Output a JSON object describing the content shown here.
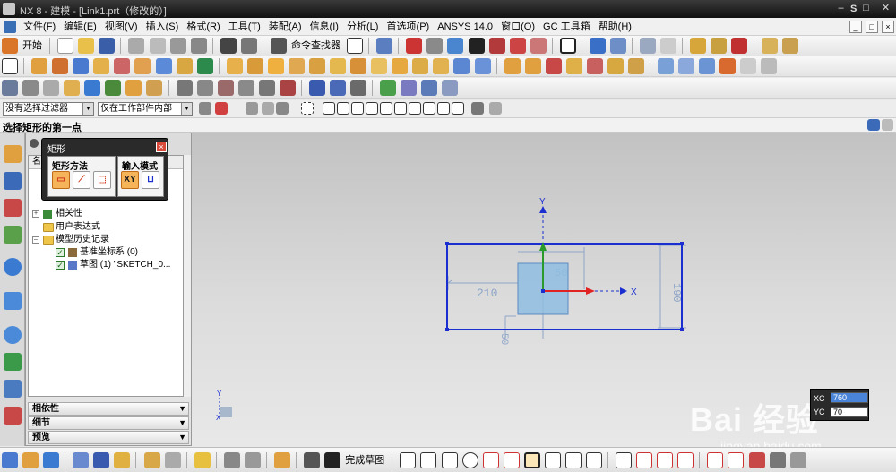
{
  "window": {
    "title": "NX 8 - 建模 - [Link1.prt（修改的）]",
    "right_label": "S",
    "minimize": "–",
    "maximize": "□",
    "close": "✕"
  },
  "menu": {
    "items": [
      "文件(F)",
      "编辑(E)",
      "视图(V)",
      "插入(S)",
      "格式(R)",
      "工具(T)",
      "装配(A)",
      "信息(I)",
      "分析(L)",
      "首选项(P)",
      "ANSYS 14.0",
      "窗口(O)",
      "GC 工具箱",
      "帮助(H)"
    ],
    "mdi_minimize": "_",
    "mdi_restore": "□",
    "mdi_close": "×"
  },
  "toolbar1": {
    "start_label": "开始",
    "command_finder_label": "命令查找器"
  },
  "selection_bar": {
    "filter_value": "没有选择过滤器",
    "scope_value": "仅在工作部件内部"
  },
  "prompt": {
    "text": "选择矩形的第一点"
  },
  "navigator": {
    "column_header": "名称",
    "items": [
      {
        "label": "相关性"
      },
      {
        "label": "用户表达式"
      },
      {
        "label": "模型历史记录"
      },
      {
        "label": "基准坐标系 (0)"
      },
      {
        "label": "草图 (1) \"SKETCH_0..."
      }
    ],
    "sections": [
      "相依性",
      "细节",
      "预览"
    ]
  },
  "rect_dialog": {
    "title": "矩形",
    "close": "×",
    "method_label": "矩形方法",
    "input_mode_label": "输入模式",
    "xy_label": "XY"
  },
  "sketch": {
    "axis_x_label": "X",
    "axis_y_label": "Y",
    "dims": {
      "width": "210",
      "small_width": "50",
      "height": "190",
      "offset": "50"
    },
    "colors": {
      "outline": "#1b2fd0",
      "dimension": "#8ea6c8",
      "rect_fill": "#8fbde0",
      "axis_x": "#e02222",
      "axis_y": "#2a9a2a"
    }
  },
  "wcs": {
    "x_label": "X",
    "y_label": "Y"
  },
  "dynamic_input": {
    "xc_label": "XC",
    "yc_label": "YC",
    "xc_value": "760",
    "yc_value": "70"
  },
  "watermark": {
    "brand": "Bai 经验",
    "url": "jingyan.baidu.com"
  },
  "bottombar": {
    "finish_sketch_label": "完成草图"
  }
}
